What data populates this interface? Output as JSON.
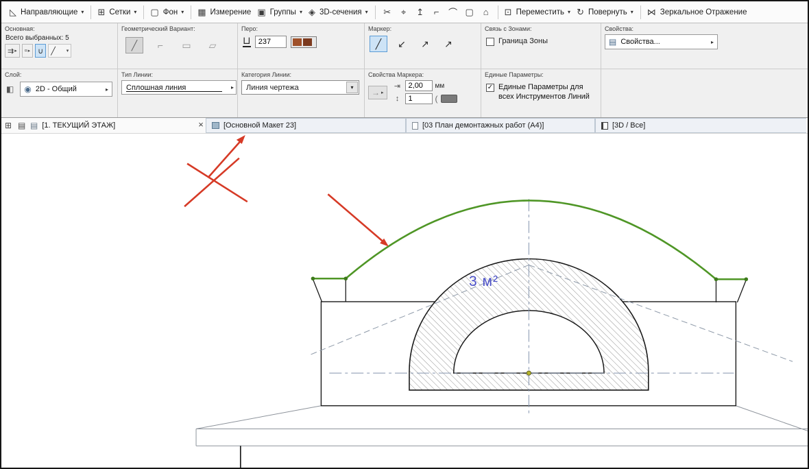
{
  "toolbar": {
    "guides": "Направляющие",
    "grids": "Сетки",
    "background": "Фон",
    "measure": "Измерение",
    "groups": "Группы",
    "sections_3d": "3D-сечения",
    "move": "Переместить",
    "rotate": "Повернуть",
    "mirror": "Зеркальное Отражение"
  },
  "infobox": {
    "main": {
      "title": "Основная:",
      "selected": "Всего выбранных: 5"
    },
    "geometry": {
      "title": "Геометрический Вариант:"
    },
    "pen": {
      "title": "Перо:",
      "value": "237"
    },
    "marker": {
      "title": "Маркер:"
    },
    "zones": {
      "title": "Связь с Зонами:",
      "checkbox": "Граница Зоны"
    },
    "properties": {
      "title": "Свойства:",
      "button": "Свойства..."
    },
    "layer": {
      "title": "Слой:",
      "value": "2D - Общий"
    },
    "line_type": {
      "title": "Тип Линии:",
      "value": "Сплошная линия"
    },
    "line_category": {
      "title": "Категория Линии:",
      "value": "Линия чертежа"
    },
    "marker_props": {
      "title": "Свойства Маркера:",
      "length": "2,00",
      "unit": "мм",
      "count": "1"
    },
    "uniform": {
      "title": "Единые Параметры:",
      "checkbox": "Единые Параметры для всех Инструментов Линий"
    }
  },
  "tabs": {
    "current": "[1. ТЕКУЩИЙ ЭТАЖ]",
    "close": "×",
    "layout": "[Основной Макет 23]",
    "plan": "[03  План демонтажных работ (А4)]",
    "three_d": "[3D / Все]"
  },
  "canvas": {
    "area_label": "3 м²"
  },
  "icons": {
    "setsquare": "◺",
    "dropdown_small": "▾",
    "expand_right": "▸",
    "grid": "⊞",
    "background": "▢",
    "measure": "▦",
    "groups": "▣",
    "sections_3d": "◈",
    "scissors": "✂",
    "zoom": "⌖",
    "fit_up": "↥",
    "corner": "⌐",
    "arc": "⌒",
    "frame": "▢",
    "home": "⌂",
    "move": "⊡",
    "rotate": "↻",
    "mirror": "⋈",
    "arrange": "⇉",
    "marquee": "▫",
    "magnet": "∪",
    "diag_line": "╱",
    "polyline": "⌐",
    "rect": "▭",
    "rotrect": "▱",
    "pen": "⊔",
    "marker_line": "╱",
    "marker_start": "↙",
    "marker_end": "↗",
    "marker_both": "↗",
    "props_list": "▤",
    "eye": "◉",
    "layer": "◧",
    "arrow_right": "→",
    "dim_h": "⇥",
    "dim_v": "↕",
    "check": "✓",
    "windows": "⊞",
    "folder": "▤"
  },
  "colors": {
    "spline_green": "#4f9626",
    "annotation_red": "#d63a26",
    "area_label_blue": "#4a4fc8",
    "pen_swatch_1": "#a0512a",
    "pen_swatch_2": "#7c3a1e",
    "selection_highlight": "#cde3f6"
  }
}
